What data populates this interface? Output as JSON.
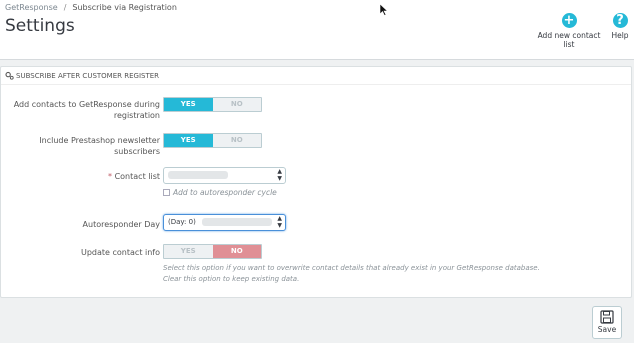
{
  "breadcrumb": {
    "root": "GetResponse",
    "separator": "/",
    "current": "Subscribe via Registration"
  },
  "page_title": "Settings",
  "toolbar": {
    "add_contact_list": {
      "label": "Add new contact list",
      "icon": "plus-circle-icon"
    },
    "help": {
      "label": "Help",
      "icon": "question-circle-icon"
    }
  },
  "panel": {
    "heading": "SUBSCRIBE AFTER CUSTOMER REGISTER",
    "fields": {
      "add_contacts": {
        "label_line1": "Add contacts to GetResponse during",
        "label_line2": "registration",
        "yes": "YES",
        "no": "NO",
        "selected": "YES"
      },
      "include_newsletter": {
        "label_line1": "Include Prestashop newsletter",
        "label_line2": "subscribers",
        "yes": "YES",
        "no": "NO",
        "selected": "YES"
      },
      "contact_list": {
        "required_mark": "*",
        "label": "Contact list",
        "value": ""
      },
      "autoresponder_checkbox": {
        "label": "Add to autoresponder cycle",
        "checked": false
      },
      "autoresponder_day": {
        "label": "Autoresponder Day",
        "value": "(Day: 0)"
      },
      "update_contact_info": {
        "label": "Update contact info",
        "yes": "YES",
        "no": "NO",
        "selected": "NO",
        "help_line1": "Select this option if you want to overwrite contact details that already exist in your GetResponse database.",
        "help_line2": "Clear this option to keep existing data."
      }
    }
  },
  "save_button": {
    "label": "Save",
    "icon": "floppy-disk-icon"
  },
  "colors": {
    "accent": "#25b9d7",
    "no_selected": "#e08f95",
    "required": "#c05c67"
  }
}
